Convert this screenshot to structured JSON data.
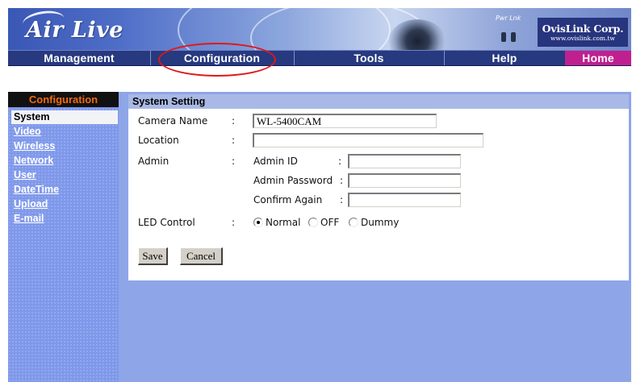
{
  "header": {
    "logo_text": "Air Live",
    "power_label": "Pwr Lnk",
    "brand_name": "OvisLink Corp.",
    "brand_url": "www.ovislink.com.tw"
  },
  "nav": {
    "items": [
      {
        "label": "Management"
      },
      {
        "label": "Configuration"
      },
      {
        "label": "Tools"
      },
      {
        "label": "Help"
      },
      {
        "label": "Home"
      }
    ],
    "highlight_color": "#e01818",
    "home_color": "#c0208f"
  },
  "sidebar": {
    "title": "Configuration",
    "items": [
      {
        "label": "System",
        "selected": true
      },
      {
        "label": "Video"
      },
      {
        "label": "Wireless"
      },
      {
        "label": "Network"
      },
      {
        "label": "User"
      },
      {
        "label": "DateTime"
      },
      {
        "label": "Upload"
      },
      {
        "label": "E-mail"
      }
    ]
  },
  "form": {
    "title": "System Setting",
    "colon": ":",
    "camera_name": {
      "label": "Camera Name",
      "value": "WL-5400CAM"
    },
    "location": {
      "label": "Location",
      "value": ""
    },
    "admin": {
      "label": "Admin",
      "admin_id": {
        "label": "Admin ID",
        "value": ""
      },
      "admin_password": {
        "label": "Admin Password",
        "value": ""
      },
      "confirm_again": {
        "label": "Confirm Again",
        "value": ""
      }
    },
    "led_control": {
      "label": "LED Control",
      "options": [
        "Normal",
        "OFF",
        "Dummy"
      ],
      "selected": "Normal"
    },
    "save_label": "Save",
    "cancel_label": "Cancel"
  }
}
